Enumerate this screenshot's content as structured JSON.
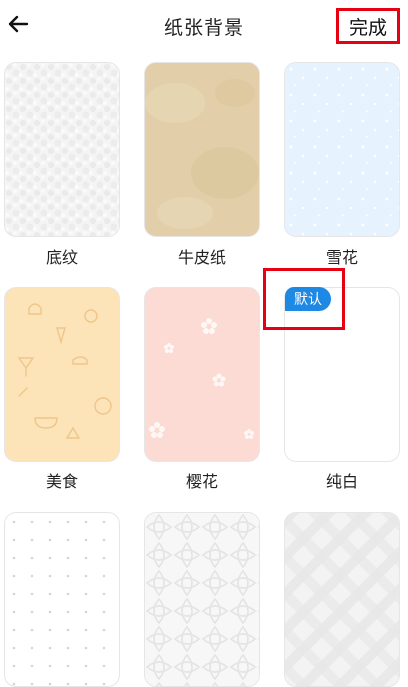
{
  "header": {
    "title": "纸张背景",
    "done_label": "完成",
    "back_icon": "back-arrow-icon"
  },
  "backgrounds": [
    {
      "label": "底纹",
      "style": "texture"
    },
    {
      "label": "牛皮纸",
      "style": "kraft"
    },
    {
      "label": "雪花",
      "style": "snow"
    },
    {
      "label": "美食",
      "style": "food"
    },
    {
      "label": "樱花",
      "style": "sakura"
    },
    {
      "label": "纯白",
      "style": "white",
      "badge": "默认"
    },
    {
      "label": "",
      "style": "dots"
    },
    {
      "label": "",
      "style": "lattice"
    },
    {
      "label": "",
      "style": "plaid"
    }
  ],
  "colors": {
    "highlight": "#e60012",
    "badge": "#1e88e5",
    "kraft": "#e3d1ac",
    "snow": "#e8f3fd",
    "food": "#fde4ba",
    "sakura": "#fbdcd4"
  }
}
